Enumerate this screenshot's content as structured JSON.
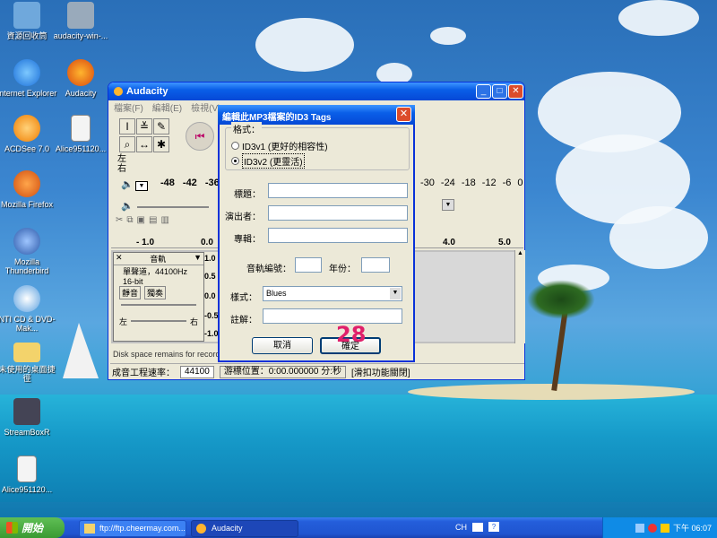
{
  "desktop": {
    "icons": [
      {
        "label": "資源回收筒",
        "icon": "recycle-bin-icon"
      },
      {
        "label": "audacity-win-...",
        "icon": "installer-icon"
      },
      {
        "label": "Internet Explorer",
        "icon": "internet-explorer-icon"
      },
      {
        "label": "Audacity",
        "icon": "audacity-icon"
      },
      {
        "label": "ACDSee 7.0",
        "icon": "acdsee-icon"
      },
      {
        "label": "Alice951120...",
        "icon": "document-icon"
      },
      {
        "label": "Mozilla Firefox",
        "icon": "firefox-icon"
      },
      {
        "label": "Mozilla Thunderbird",
        "icon": "thunderbird-icon"
      },
      {
        "label": "NTI CD & DVD-Mak...",
        "icon": "nti-icon"
      },
      {
        "label": "未使用的桌面捷徑",
        "icon": "folder-icon"
      },
      {
        "label": "StreamBoxR",
        "icon": "streambox-icon"
      },
      {
        "label": "Alice951120...",
        "icon": "document-icon"
      }
    ]
  },
  "audacity": {
    "title": "Audacity",
    "menu": [
      "檔案(F)",
      "編輯(E)",
      "檢視(V)"
    ],
    "meter_labels": [
      "左",
      "右"
    ],
    "meter_ticks": [
      "-48",
      "-42",
      "-36"
    ],
    "meter_ticks_right": [
      "-30",
      "-24",
      "-18",
      "-12",
      "-6",
      "0"
    ],
    "ruler_ticks": [
      "- 1.0",
      "0.0",
      "4.0",
      "5.0"
    ],
    "track": {
      "name": "音軌",
      "info": "單聲道，44100Hz",
      "bits": "16-bit",
      "mute": "靜音",
      "solo": "獨奏",
      "pan_left": "左",
      "pan_right": "右",
      "scale": [
        "1.0",
        "0.5",
        "0.0",
        "-0.5",
        "-1.0"
      ]
    },
    "status_message": "Disk space remains for recordi",
    "rate_label": "成音工程速率：",
    "rate_value": "44100",
    "cursor_text": "游標位置：0:00.000000 分:秒",
    "snap_text": "[滑扣功能關閉]"
  },
  "dialog": {
    "title": "編輯此MP3檔案的ID3 Tags",
    "format_label": "格式：",
    "opt_v1": "ID3v1 (更好的相容性)",
    "opt_v2": "ID3v2 (更靈活)",
    "selected": "ID3v2",
    "title_label": "標題：",
    "artist_label": "演出者：",
    "album_label": "專輯：",
    "track_label": "音軌編號：",
    "year_label": "年份：",
    "genre_label": "樣式：",
    "genre_value": "Blues",
    "comment_label": "註解：",
    "cancel": "取消",
    "ok": "確定"
  },
  "overlay_number": "28",
  "taskbar": {
    "start": "開始",
    "tasks": [
      "ftp://ftp.cheermay.com...",
      "Audacity"
    ],
    "lang": "CH",
    "clock": "下午 06:07"
  }
}
